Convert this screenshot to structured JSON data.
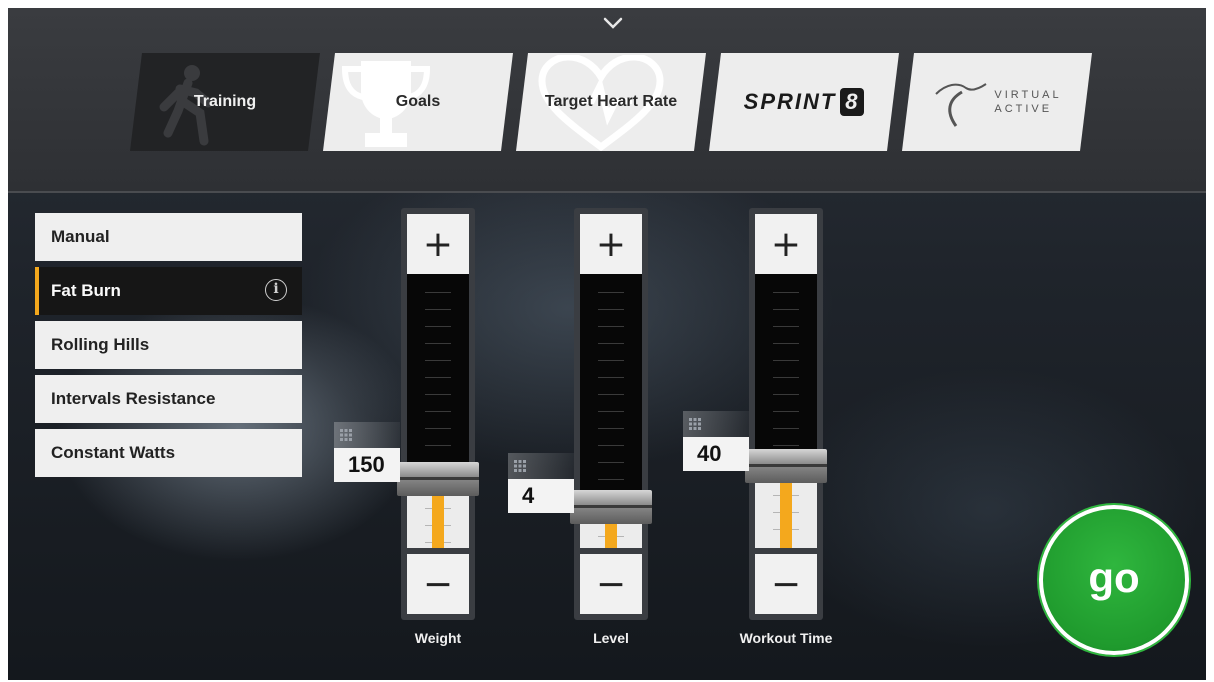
{
  "tabs": [
    {
      "label": "Training",
      "active": true,
      "icon": "runner-icon"
    },
    {
      "label": "Goals",
      "active": false,
      "icon": "trophy-icon"
    },
    {
      "label": "Target Heart Rate",
      "active": false,
      "icon": "heart-rate-icon"
    },
    {
      "label": "SPRINT",
      "badge": "8",
      "active": false,
      "icon": "sprint8-logo"
    },
    {
      "label_line1": "VIRTUAL",
      "label_line2": "ACTIVE",
      "active": false,
      "icon": "virtual-active-logo"
    }
  ],
  "workouts": [
    {
      "label": "Manual",
      "active": false
    },
    {
      "label": "Fat Burn",
      "active": true,
      "info": "i"
    },
    {
      "label": "Rolling Hills",
      "active": false
    },
    {
      "label": "Intervals Resistance",
      "active": false
    },
    {
      "label": "Constant Watts",
      "active": false
    }
  ],
  "sliders": [
    {
      "label": "Weight",
      "value": "150",
      "fill_fraction": 0.25
    },
    {
      "label": "Level",
      "value": "4",
      "fill_fraction": 0.15
    },
    {
      "label": "Workout Time",
      "value": "40",
      "fill_fraction": 0.3
    }
  ],
  "plus_symbol": "+",
  "minus_symbol": "−",
  "go_label": "go",
  "colors": {
    "accent": "#f4a81d",
    "go_green": "#1f9a2d",
    "panel_light": "#efefef",
    "panel_dark": "#161616"
  }
}
